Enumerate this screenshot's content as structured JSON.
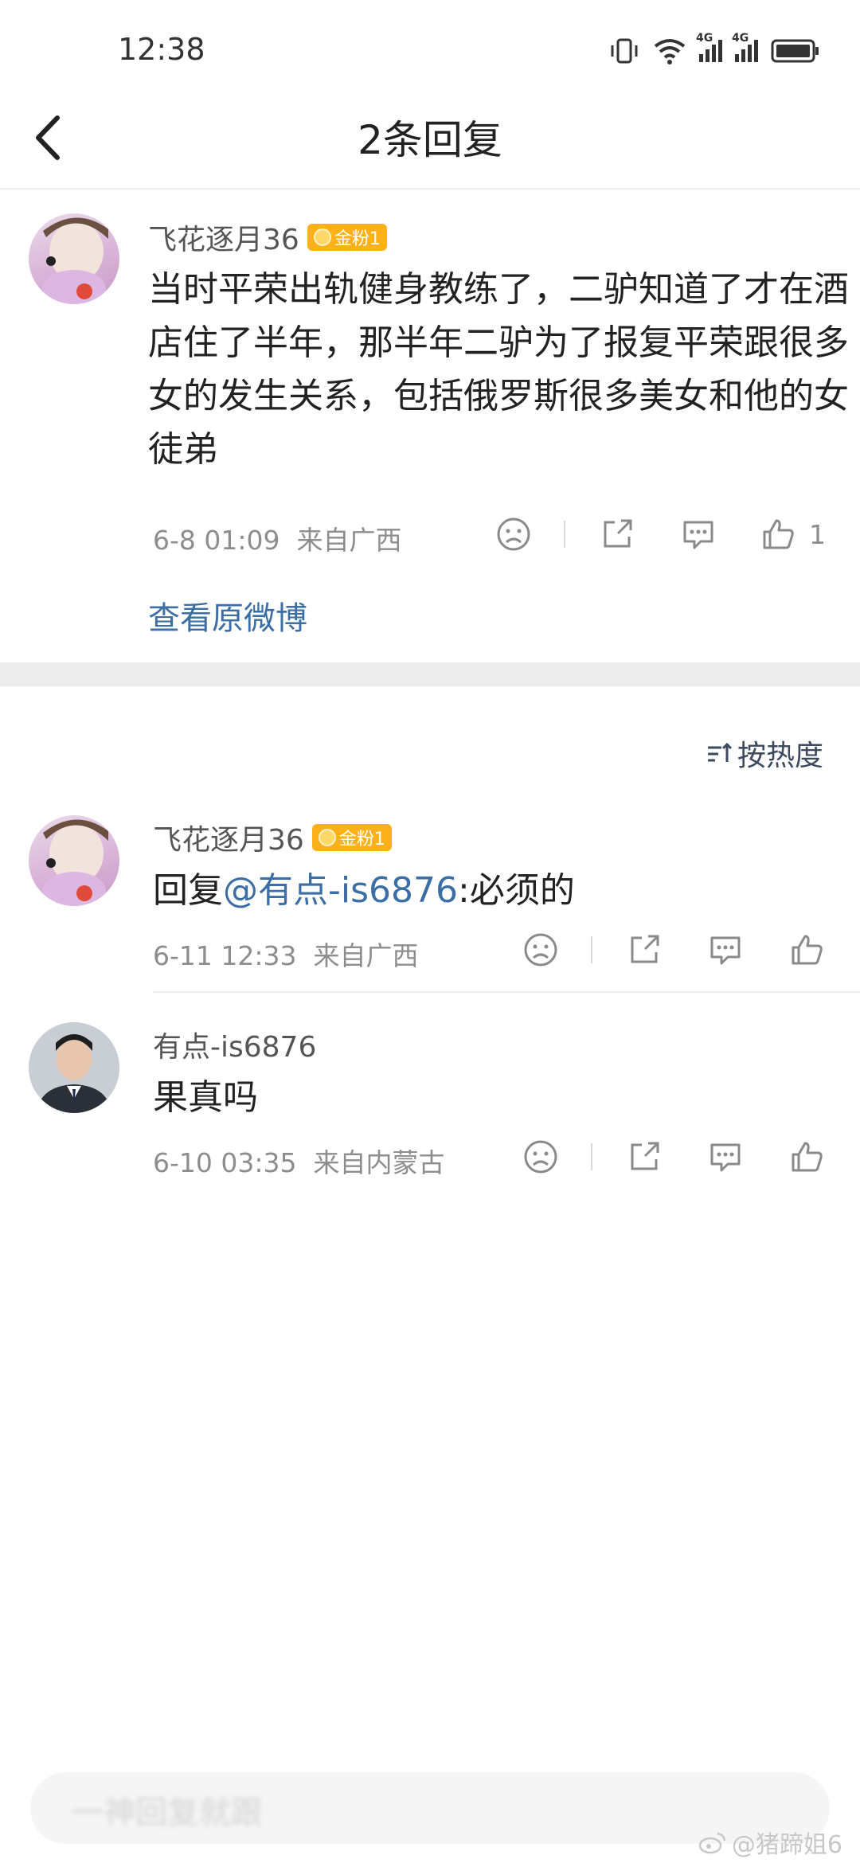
{
  "status_bar": {
    "time": "12:38",
    "network_1": "4G",
    "network_2": "4G"
  },
  "nav": {
    "title": "2条回复"
  },
  "main_comment": {
    "username": "飞花逐月36",
    "badge": "金粉1",
    "text": "当时平荣出轨健身教练了，二驴知道了才在酒店住了半年，那半年二驴为了报复平荣跟很多女的发生关系，包括俄罗斯很多美女和他的女徒弟",
    "time": "6-8 01:09",
    "location": "来自广西",
    "like_count": "1",
    "view_original": "查看原微博"
  },
  "sort": {
    "label": "按热度"
  },
  "replies": [
    {
      "username": "飞花逐月36",
      "badge": "金粉1",
      "text_prefix": "回复",
      "mention": "@有点-is6876",
      "text_suffix": ":必须的",
      "time": "6-11 12:33",
      "location": "来自广西"
    },
    {
      "username": "有点-is6876",
      "text": "果真吗",
      "time": "6-10 03:35",
      "location": "来自内蒙古"
    }
  ],
  "bottom_bar": {
    "placeholder": "一神回复就跟"
  },
  "watermark": {
    "text": "@猪蹄姐6"
  },
  "colors": {
    "link": "#3a6ea5",
    "badge": "#ffb11a",
    "meta": "#8d8d8d"
  }
}
